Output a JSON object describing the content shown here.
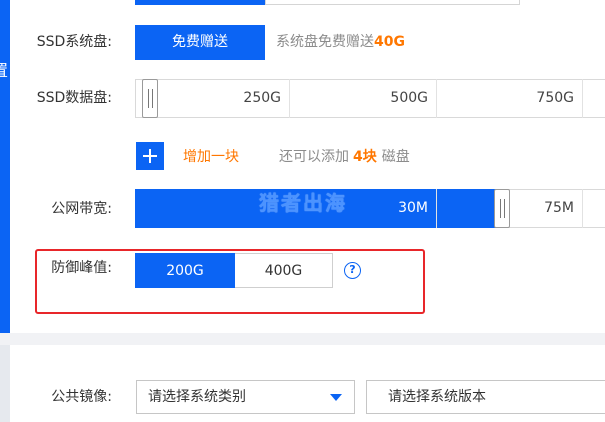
{
  "theme": {
    "primary": "#0b64f4",
    "accent": "#ff7700",
    "muted": "#8c8c8c",
    "annotation": "#e8262a"
  },
  "section": {
    "side_label": "置"
  },
  "system_disk": {
    "label": "SSD系统盘:",
    "button_label": "免费赠送",
    "note_prefix": "系统盘免费赠送",
    "note_amount": "40G"
  },
  "data_disk": {
    "label": "SSD数据盘:",
    "ticks": [
      "250G",
      "500G",
      "750G"
    ],
    "value": 0
  },
  "add_disk": {
    "button_icon": "plus-icon",
    "label": "增加一块",
    "remaining_prefix": "还可以添加",
    "remaining_amount": "4块",
    "remaining_suffix": "磁盘"
  },
  "bandwidth": {
    "label": "公网带宽:",
    "ticks": [
      "30M",
      "75M"
    ],
    "value": 50
  },
  "watermark": "猎者出海",
  "protection": {
    "label": "防御峰值:",
    "options": [
      "200G",
      "400G"
    ],
    "selected_index": 0,
    "help_icon": "question-circle-icon"
  },
  "image": {
    "label": "公共镜像:",
    "type_placeholder": "请选择系统类别",
    "version_placeholder": "请选择系统版本",
    "dropdown_icon": "caret-down-icon"
  }
}
